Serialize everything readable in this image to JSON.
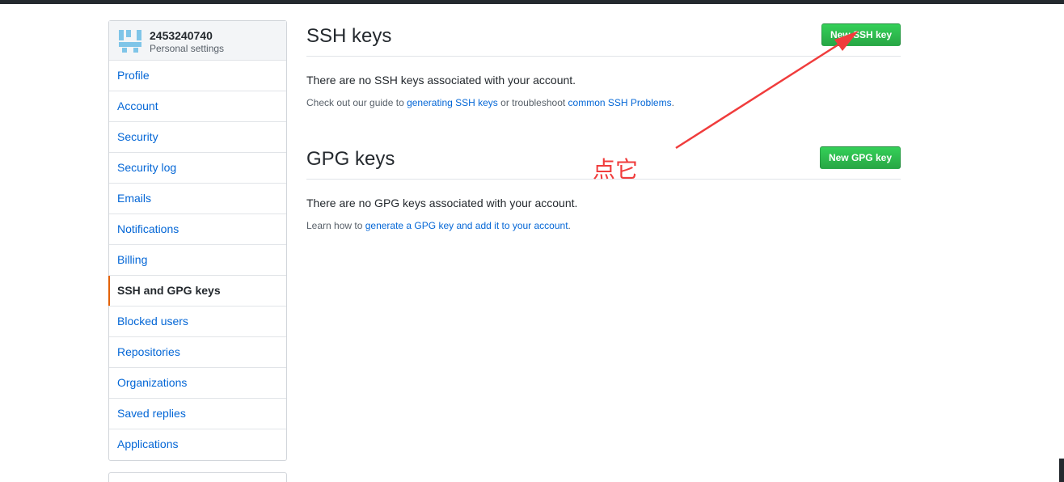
{
  "sidebar": {
    "username": "2453240740",
    "subtitle": "Personal settings",
    "items": [
      {
        "label": "Profile",
        "name": "profile"
      },
      {
        "label": "Account",
        "name": "account"
      },
      {
        "label": "Security",
        "name": "security"
      },
      {
        "label": "Security log",
        "name": "security-log"
      },
      {
        "label": "Emails",
        "name": "emails"
      },
      {
        "label": "Notifications",
        "name": "notifications"
      },
      {
        "label": "Billing",
        "name": "billing"
      },
      {
        "label": "SSH and GPG keys",
        "name": "ssh-gpg-keys"
      },
      {
        "label": "Blocked users",
        "name": "blocked-users"
      },
      {
        "label": "Repositories",
        "name": "repositories"
      },
      {
        "label": "Organizations",
        "name": "organizations"
      },
      {
        "label": "Saved replies",
        "name": "saved-replies"
      },
      {
        "label": "Applications",
        "name": "applications"
      }
    ],
    "active_index": 7
  },
  "ssh": {
    "title": "SSH keys",
    "button": "New SSH key",
    "empty_message": "There are no SSH keys associated with your account.",
    "note_prefix": "Check out our guide to ",
    "note_link1": "generating SSH keys",
    "note_mid": " or troubleshoot ",
    "note_link2": "common SSH Problems",
    "note_suffix": "."
  },
  "gpg": {
    "title": "GPG keys",
    "button": "New GPG key",
    "empty_message": "There are no GPG keys associated with your account.",
    "note_prefix": "Learn how to ",
    "note_link": "generate a GPG key and add it to your account",
    "note_suffix": "."
  },
  "annotation": {
    "text": "点它",
    "color": "#f03c3c"
  },
  "colors": {
    "link": "#0366d6",
    "button_green": "#28a745",
    "active_marker": "#e36209"
  }
}
